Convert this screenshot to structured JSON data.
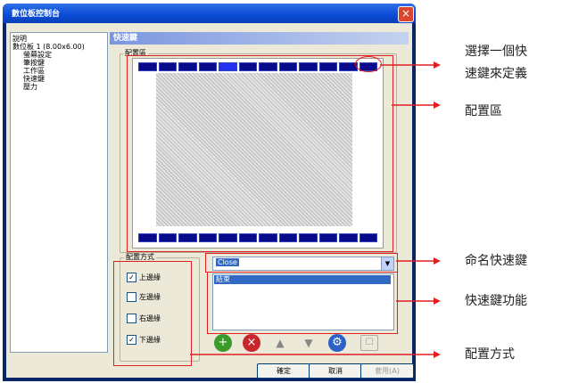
{
  "window": {
    "title": "數位板控制台",
    "close_icon": "close-icon"
  },
  "tree": {
    "items": [
      "說明",
      "數位板 1 (8.00x6.00)",
      "螢幕設定",
      "筆按鍵",
      "工作區",
      "快速鍵",
      "壓力"
    ]
  },
  "panel": {
    "heading": "快速鍵",
    "layout_area_label": "配置區"
  },
  "layout": {
    "group_label": "配置方式",
    "options": [
      {
        "label": "上邊緣",
        "checked": true,
        "mark": "✓"
      },
      {
        "label": "左邊緣",
        "checked": false,
        "mark": ""
      },
      {
        "label": "右邊緣",
        "checked": false,
        "mark": ""
      },
      {
        "label": "下邊緣",
        "checked": true,
        "mark": "✓"
      }
    ]
  },
  "hotkey": {
    "name_value": "Close",
    "function_item": "結束"
  },
  "toolbar": {
    "icons": [
      "add-icon",
      "delete-icon",
      "move-up-icon",
      "move-down-icon",
      "settings-icon",
      "properties-icon"
    ]
  },
  "buttons": {
    "ok": "確定",
    "cancel": "取消",
    "apply": "套用(A)"
  },
  "annotations": {
    "select_line1": "選擇一個快",
    "select_line2": "速鍵來定義",
    "layout_area": "配置區",
    "name_hotkey": "命名快速鍵",
    "hotkey_function": "快速鍵功能",
    "layout_method": "配置方式"
  },
  "colors": {
    "accent": "#316ac5",
    "annotation": "#e02020",
    "key": "#0a0a8c"
  }
}
